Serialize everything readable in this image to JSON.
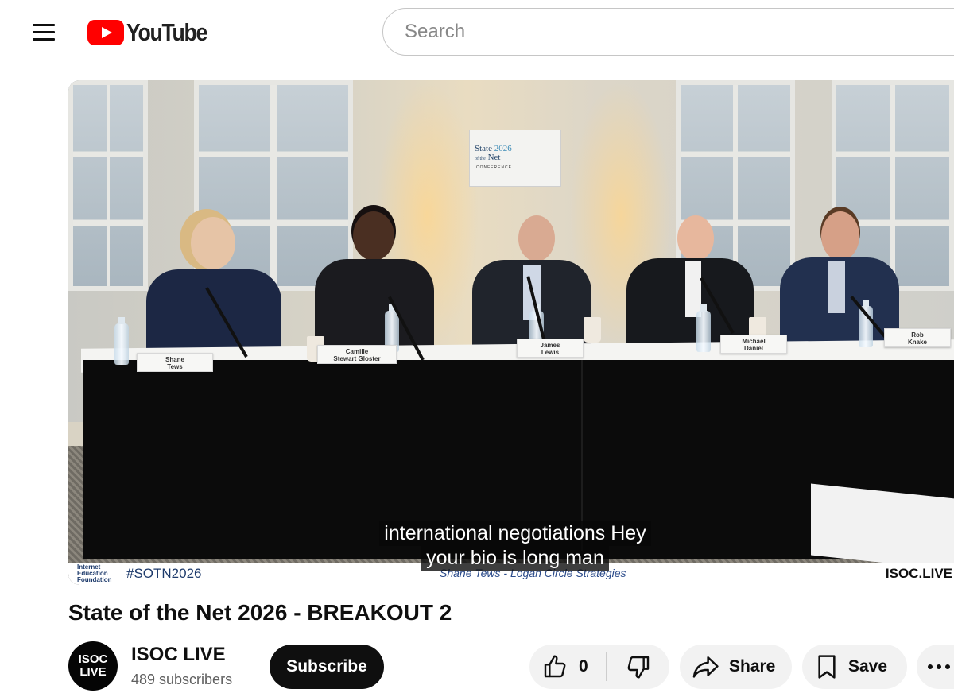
{
  "header": {
    "logo_text": "YouTube",
    "search_placeholder": "Search"
  },
  "player": {
    "caption_lines": [
      "international negotiations Hey",
      "your bio is long man"
    ],
    "conference_sign": {
      "title_lines": [
        "State",
        "of the",
        "Net"
      ],
      "year": "2026",
      "subtitle": "CONFERENCE"
    },
    "nameplates": [
      {
        "name": "Shane\nTews"
      },
      {
        "name": "Camille\nStewart Gloster"
      },
      {
        "name": "James\nLewis"
      },
      {
        "name": "Michael\nDaniel"
      },
      {
        "name": "Rob\nKnake"
      }
    ],
    "lower_third": {
      "org_logo": "Internet\nEducation\nFoundation",
      "hashtag": "#SOTN2026",
      "speaker_line": "Shane Tews - Logan Circle Strategies",
      "watermark": "ISOC.LIVE"
    }
  },
  "video": {
    "title": "State of the Net 2026 - BREAKOUT 2"
  },
  "channel": {
    "avatar_text": "ISOC\nLIVE",
    "name": "ISOC LIVE",
    "subscribers": "489 subscribers",
    "subscribe_label": "Subscribe"
  },
  "actions": {
    "like_count": "0",
    "share_label": "Share",
    "save_label": "Save"
  },
  "icons": {
    "menu": "hamburger-menu-icon",
    "like": "thumbs-up-icon",
    "dislike": "thumbs-down-icon",
    "share": "share-arrow-icon",
    "save": "bookmark-icon",
    "more": "more-horizontal-icon"
  },
  "colors": {
    "brand_red": "#ff0000",
    "text_primary": "#0f0f0f",
    "text_secondary": "#606060",
    "button_bg": "#f2f2f2",
    "subscribe_bg": "#0f0f0f"
  }
}
